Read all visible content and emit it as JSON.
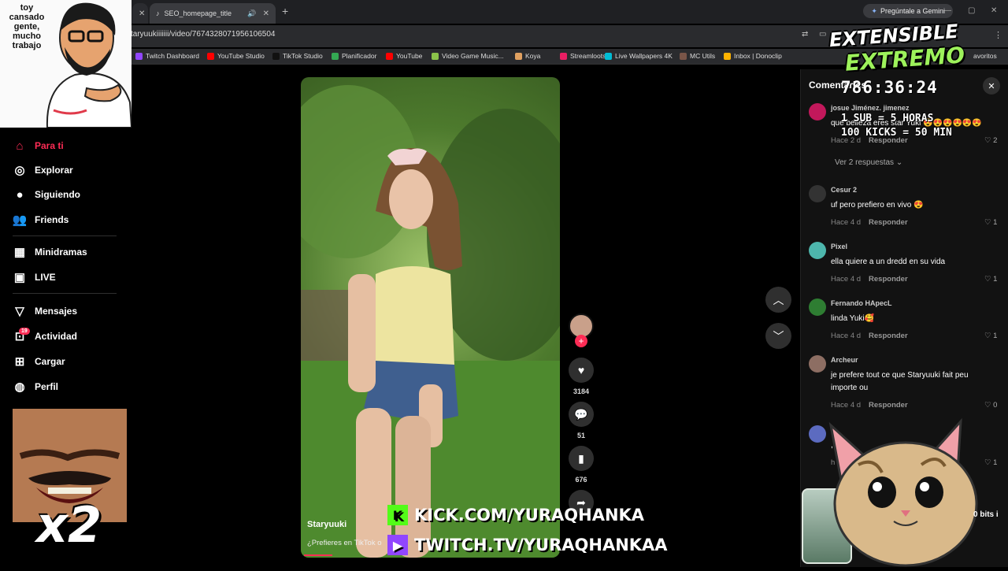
{
  "browser": {
    "active_tab": "SEO_homepage_title",
    "gemini_button": "Pregúntale a Gemini",
    "url": "taryuukiiiiiii/video/7674328071956106504",
    "bookmarks_more": "avoritos"
  },
  "bookmarks": [
    {
      "label": "Twitch Dashboard",
      "color": "#9146ff",
      "icon": "twitch-icon"
    },
    {
      "label": "YouTube Studio",
      "color": "#ff0000",
      "icon": "youtube-icon"
    },
    {
      "label": "TikTok Studio",
      "color": "#111111",
      "icon": "tiktok-icon"
    },
    {
      "label": "Planificador",
      "color": "#34a853",
      "icon": "planner-icon"
    },
    {
      "label": "YouTube",
      "color": "#ff0000",
      "icon": "youtube-icon"
    },
    {
      "label": "Video Game Music...",
      "color": "#8bc34a",
      "icon": "music-icon"
    },
    {
      "label": "Koya",
      "color": "#e0a060",
      "icon": "koya-icon"
    },
    {
      "label": "Streamloots",
      "color": "#e91e63",
      "icon": "streamloots-icon"
    },
    {
      "label": "Live Wallpapers 4K",
      "color": "#00bcd4",
      "icon": "wallpaper-icon"
    },
    {
      "label": "MC Utils",
      "color": "#795548",
      "icon": "mc-icon"
    },
    {
      "label": "Inbox | Donoclip",
      "color": "#ffb300",
      "icon": "inbox-icon"
    }
  ],
  "sidebar": {
    "items": [
      {
        "label": "Para ti",
        "icon": "home-icon"
      },
      {
        "label": "Explorar",
        "icon": "compass-icon"
      },
      {
        "label": "Siguiendo",
        "icon": "following-avatar-icon"
      },
      {
        "label": "Friends",
        "icon": "friends-icon"
      },
      {
        "label": "Minidramas",
        "icon": "film-icon"
      },
      {
        "label": "LIVE",
        "icon": "tv-icon"
      },
      {
        "label": "Mensajes",
        "icon": "send-icon"
      },
      {
        "label": "Actividad",
        "icon": "activity-icon"
      },
      {
        "label": "Cargar",
        "icon": "upload-icon"
      },
      {
        "label": "Perfil",
        "icon": "profile-icon"
      }
    ],
    "activity_badge": "19"
  },
  "meme": {
    "text": "toy cansado gente, mucho trabajo",
    "multiplier": "x2"
  },
  "video": {
    "author": "Staryuuki",
    "description": "¿Prefieres en TikTok o"
  },
  "actions": {
    "likes": "3184",
    "comments": "51",
    "saves": "676"
  },
  "comments": {
    "title": "Comentarios",
    "view_replies": "Ver 2 respuestas",
    "reply_label": "Responder",
    "list": [
      {
        "user": "josue Jiménez. jimenez",
        "text": "que belleza eres star Yuki 😍😍😍😍😍😍",
        "time": "Hace 2 d",
        "likes": "2",
        "color": "#c2185b"
      },
      {
        "user": "Cesur 2",
        "text": "uf pero prefiero en vivo 😍",
        "time": "Hace 4 d",
        "likes": "1",
        "color": "#333333"
      },
      {
        "user": "Pixel",
        "text": "ella quiere a un dredd en su vida",
        "time": "Hace 4 d",
        "likes": "1",
        "color": "#4db6ac"
      },
      {
        "user": "Fernando HApecL",
        "text": "linda Yuki🥰",
        "time": "Hace 4 d",
        "likes": "1",
        "color": "#2e7d32"
      },
      {
        "user": "Archeur",
        "text": "je prefere tout ce que Staryuuki fait peu importe ou",
        "time": "Hace 4 d",
        "likes": "0",
        "color": "#8d6e63"
      },
      {
        "user": "",
        "text": ", se le",
        "time": "h",
        "likes": "1",
        "color": "#5c6bc0"
      }
    ]
  },
  "stream": {
    "logo_line1": "EXTENSIBLE",
    "logo_line2": "EXTREMO",
    "timer": "786:36:24",
    "sub_rule": "1 SUB = 5 HORAS",
    "kick_rule": "100 KICKS = 50 MIN",
    "kick_url": "KICK.COM/YURAQHANKA",
    "twitch_url": "TWITCH.TV/YURAQHANKAA",
    "bits": "0 bits i"
  }
}
